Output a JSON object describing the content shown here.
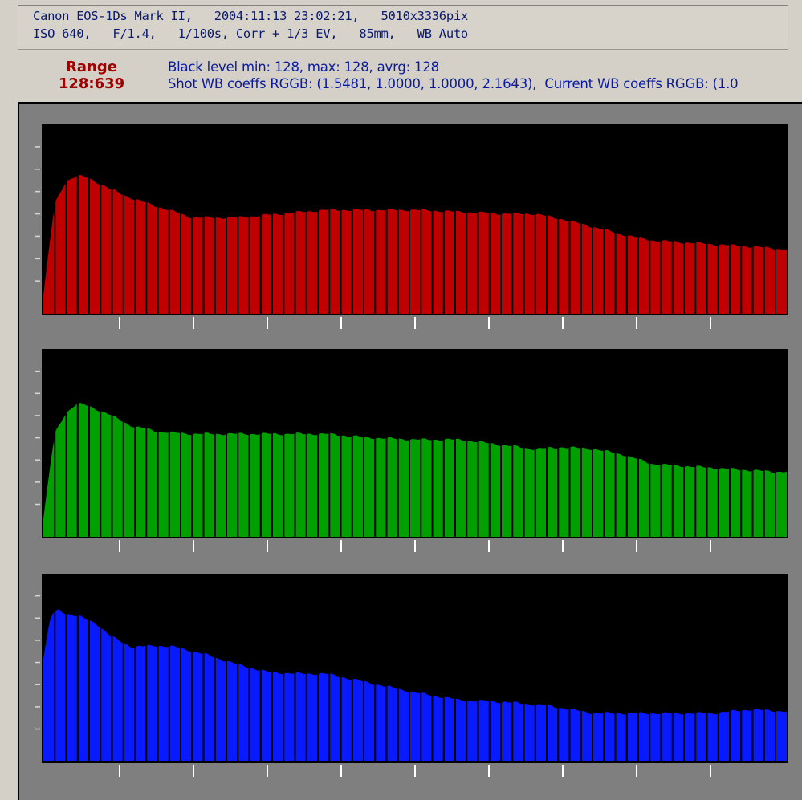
{
  "exif": {
    "line1": "Canon EOS-1Ds Mark II,   2004:11:13 23:02:21,   5010x3336pix",
    "line2": "ISO 640,   F/1.4,   1/100s, Corr + 1/3 EV,   85mm,   WB Auto"
  },
  "range": {
    "title": "Range",
    "value": "128:639"
  },
  "black_level": "Black level min: 128, max: 128, avrg: 128",
  "wb_line": "Shot WB coeffs RGGB: (1.5481, 1.0000, 1.0000, 2.1643),  Current WB coeffs RGGB: (1.0",
  "colors": {
    "red": "#c00000",
    "green": "#00a000",
    "blue": "#0a1aff",
    "plot_bg": "#000000",
    "panel_bg": "#7f7f7f"
  },
  "chart_data": [
    {
      "type": "bar",
      "channel": "red",
      "xlim": [
        0,
        1
      ],
      "ylim": [
        0,
        1
      ],
      "x": [
        0,
        0.015,
        0.03,
        0.045,
        0.06,
        0.09,
        0.12,
        0.16,
        0.2,
        0.26,
        0.32,
        0.38,
        0.44,
        0.5,
        0.56,
        0.62,
        0.66,
        0.7,
        0.74,
        0.78,
        0.82,
        0.86,
        0.9,
        0.94,
        0.98,
        1.0
      ],
      "values": [
        0.1,
        0.58,
        0.7,
        0.73,
        0.72,
        0.66,
        0.61,
        0.56,
        0.51,
        0.51,
        0.53,
        0.55,
        0.55,
        0.55,
        0.54,
        0.53,
        0.53,
        0.5,
        0.46,
        0.42,
        0.39,
        0.38,
        0.37,
        0.36,
        0.35,
        0.34
      ]
    },
    {
      "type": "bar",
      "channel": "green",
      "xlim": [
        0,
        1
      ],
      "ylim": [
        0,
        1
      ],
      "x": [
        0,
        0.015,
        0.03,
        0.045,
        0.06,
        0.09,
        0.12,
        0.16,
        0.2,
        0.26,
        0.32,
        0.38,
        0.44,
        0.5,
        0.56,
        0.62,
        0.66,
        0.7,
        0.74,
        0.78,
        0.82,
        0.86,
        0.9,
        0.94,
        0.98,
        1.0
      ],
      "values": [
        0.1,
        0.55,
        0.66,
        0.71,
        0.7,
        0.65,
        0.59,
        0.56,
        0.55,
        0.55,
        0.55,
        0.55,
        0.53,
        0.52,
        0.52,
        0.49,
        0.47,
        0.48,
        0.47,
        0.44,
        0.39,
        0.38,
        0.37,
        0.36,
        0.35,
        0.35
      ]
    },
    {
      "type": "bar",
      "channel": "blue",
      "xlim": [
        0,
        1
      ],
      "ylim": [
        0,
        1
      ],
      "x": [
        0,
        0.01,
        0.02,
        0.03,
        0.05,
        0.07,
        0.09,
        0.12,
        0.15,
        0.18,
        0.22,
        0.26,
        0.3,
        0.34,
        0.38,
        0.44,
        0.5,
        0.56,
        0.62,
        0.68,
        0.74,
        0.8,
        0.86,
        0.9,
        0.95,
        1.0
      ],
      "values": [
        0.55,
        0.78,
        0.81,
        0.79,
        0.77,
        0.74,
        0.67,
        0.61,
        0.62,
        0.61,
        0.57,
        0.52,
        0.48,
        0.47,
        0.47,
        0.42,
        0.37,
        0.33,
        0.32,
        0.3,
        0.26,
        0.26,
        0.26,
        0.26,
        0.28,
        0.27
      ]
    }
  ]
}
